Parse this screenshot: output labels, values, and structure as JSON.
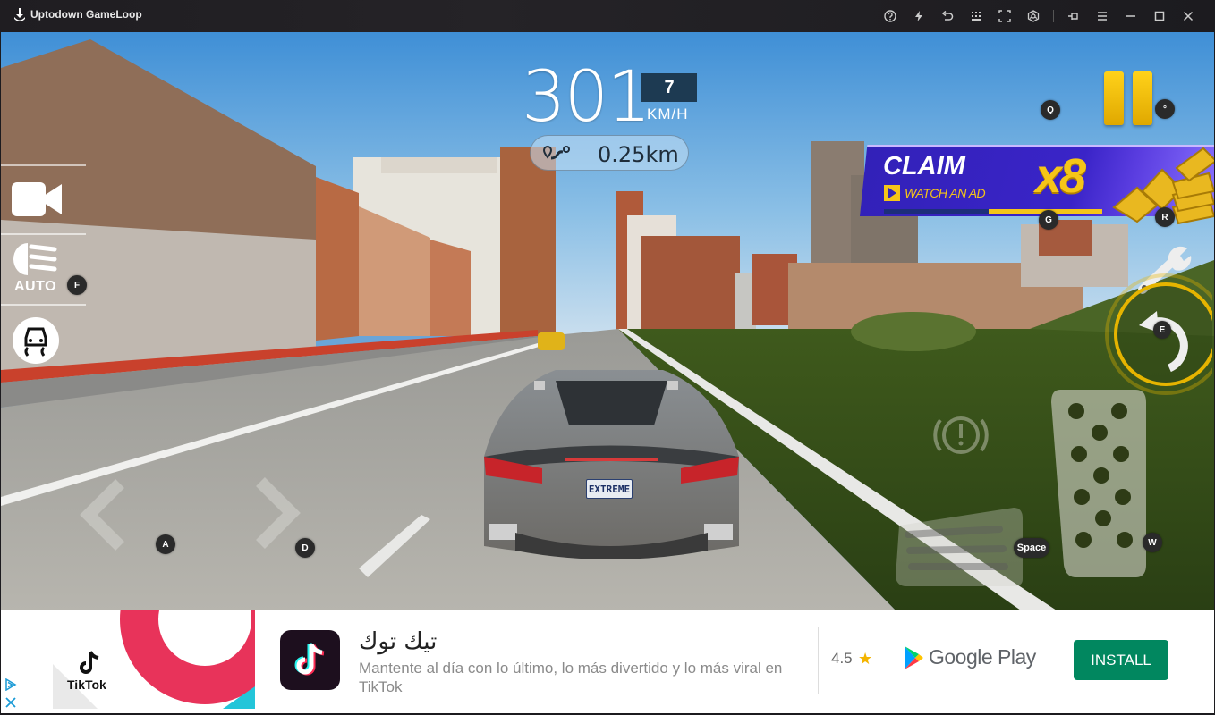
{
  "window": {
    "title": "Uptodown GameLoop",
    "toolbar_icons": [
      {
        "name": "help-icon",
        "label": "Help"
      },
      {
        "name": "boost-icon",
        "label": "Boost"
      },
      {
        "name": "back-icon",
        "label": "Back"
      },
      {
        "name": "keymap-icon",
        "label": "Keyboard mapping"
      },
      {
        "name": "fullscreen-icon",
        "label": "Fullscreen"
      },
      {
        "name": "settings-wheel-icon",
        "label": "Control settings"
      }
    ],
    "window_controls": [
      {
        "name": "pin-icon",
        "label": "Pin"
      },
      {
        "name": "menu-icon",
        "label": "Menu"
      },
      {
        "name": "minimize-icon",
        "label": "Minimize"
      },
      {
        "name": "maximize-icon",
        "label": "Maximize"
      },
      {
        "name": "close-icon",
        "label": "Close"
      }
    ]
  },
  "hud": {
    "speed": "301",
    "gear": "7",
    "speed_unit": "KM/H",
    "distance": "0.25km"
  },
  "claim": {
    "title": "CLAIM",
    "subtitle": "WATCH AN AD",
    "multiplier": "x8",
    "progress": 0.52
  },
  "controls": {
    "lights_mode": "AUTO",
    "key_bindings": {
      "lights": "F",
      "pause_left": "Q",
      "pause": "°",
      "claim": "G",
      "coins": "R",
      "reset": "E",
      "steer_left": "A",
      "steer_right": "D",
      "brake": "Space",
      "gas": "W"
    }
  },
  "scene": {
    "license_plate": "EXTREME"
  },
  "ad": {
    "banner_brand": "TikTok",
    "app_name": "تيك توك",
    "description": "Mantente al día con lo último, lo más divertido y lo más viral en TikTok",
    "rating": "4.5",
    "store": "Google Play",
    "install_label": "INSTALL",
    "colors": {
      "install": "#01875f",
      "star": "#f4b400"
    }
  },
  "colors": {
    "accent_yellow": "#f5c518",
    "claim_purple": "#3a24c8",
    "gear_box": "#1d3a52"
  }
}
